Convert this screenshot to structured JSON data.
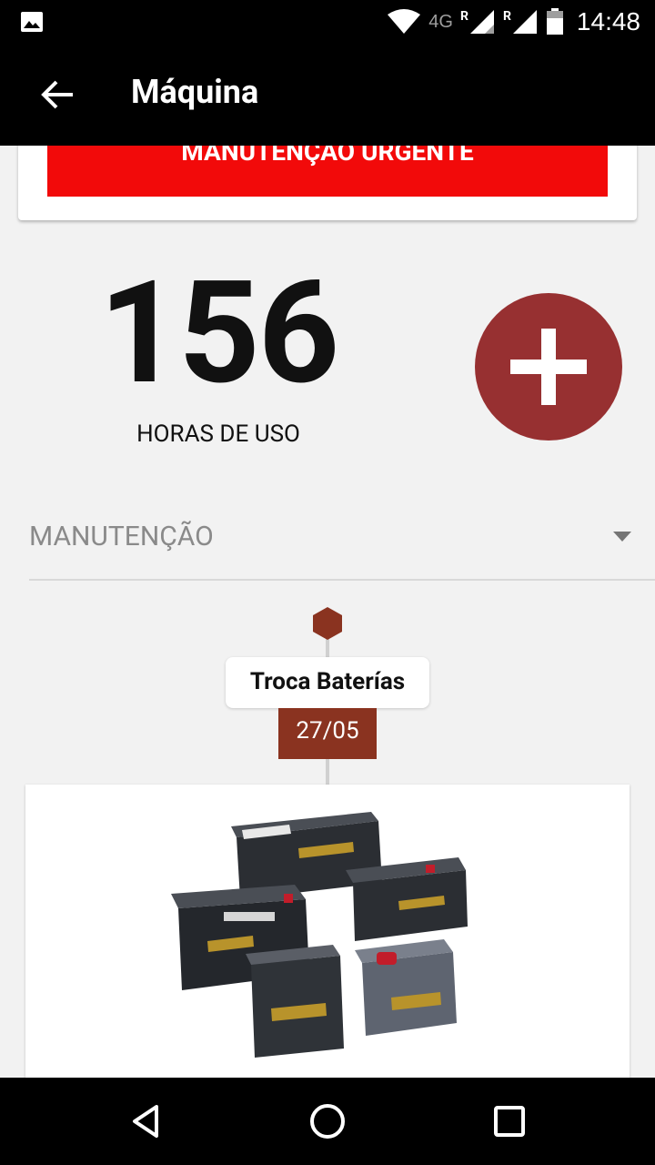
{
  "status_bar": {
    "network": "4G",
    "roaming_1": "R",
    "roaming_2": "R",
    "time": "14:48"
  },
  "app_bar": {
    "title": "Máquina"
  },
  "banner": {
    "label": "MANUTENÇÃO URGENTE",
    "color": "#f20a0a"
  },
  "hours": {
    "value": "156",
    "label": "HORAS DE USO"
  },
  "add_button": {
    "icon": "plus-icon",
    "color": "#973031"
  },
  "filter": {
    "selected": "MANUTENÇÃO"
  },
  "timeline": {
    "events": [
      {
        "title": "Troca Baterías",
        "date": "27/05",
        "image": "batteries-photo"
      }
    ],
    "accent": "#8a3320"
  },
  "nav_bar": {
    "icons": [
      "back-triangle-icon",
      "home-circle-icon",
      "recents-square-icon"
    ]
  }
}
